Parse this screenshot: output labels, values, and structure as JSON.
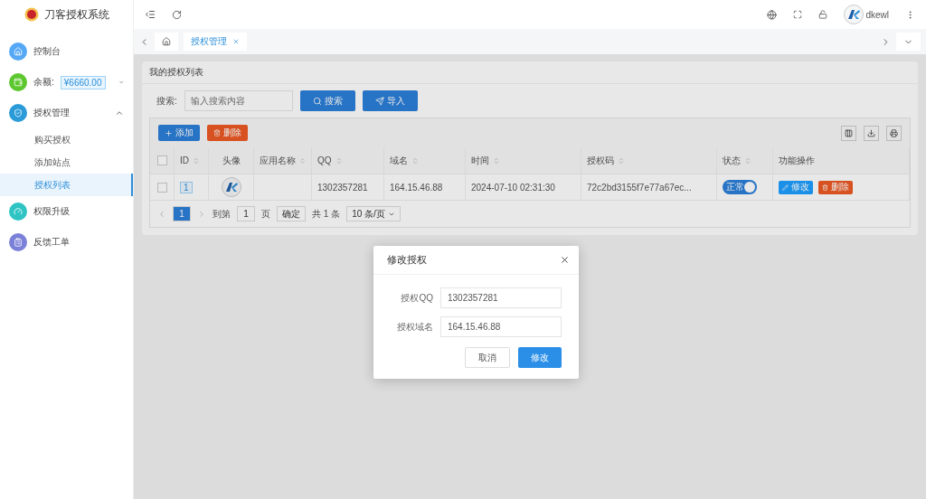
{
  "app_title": "刀客授权系统",
  "sidebar": {
    "items": [
      {
        "label": "控制台",
        "color": "#55a8f5"
      },
      {
        "label": "余额:",
        "badge": "¥6660.00",
        "color": "#5cc72e",
        "expanded": false
      },
      {
        "label": "授权管理",
        "color": "#2b9bd8",
        "expanded": true,
        "children": [
          {
            "label": "购买授权",
            "selected": false
          },
          {
            "label": "添加站点",
            "selected": false
          },
          {
            "label": "授权列表",
            "selected": true
          }
        ]
      },
      {
        "label": "权限升级",
        "color": "#2ec4c4"
      },
      {
        "label": "反馈工单",
        "color": "#7b80d8"
      }
    ]
  },
  "top_bar": {
    "user": "dkewl"
  },
  "tabs": [
    {
      "label": "授权管理",
      "selected": true
    }
  ],
  "panel": {
    "title": "我的授权列表",
    "search_label": "搜索:",
    "search_placeholder": "输入搜索内容",
    "search_button": "搜索",
    "import_button": "导入"
  },
  "table": {
    "add_button": "添加",
    "delete_button": "删除",
    "columns": [
      {
        "label": "ID",
        "sortable": true
      },
      {
        "label": "头像",
        "sortable": false
      },
      {
        "label": "应用名称",
        "sortable": true
      },
      {
        "label": "QQ",
        "sortable": true
      },
      {
        "label": "域名",
        "sortable": true
      },
      {
        "label": "时间",
        "sortable": true
      },
      {
        "label": "授权码",
        "sortable": true
      },
      {
        "label": "状态",
        "sortable": true
      },
      {
        "label": "功能操作",
        "sortable": false
      }
    ],
    "header_checked": false,
    "rows": [
      {
        "checked": false,
        "id": "1",
        "qq": "1302357281",
        "domain": "164.15.46.88",
        "time": "2024-07-10 02:31:30",
        "code": "72c2bd3155f7e77a67ec...",
        "status": {
          "label": "正常",
          "on": true
        },
        "edit": "修改",
        "delete": "删除"
      }
    ]
  },
  "pagination": {
    "current": "1",
    "goto_label": "到第",
    "goto_value": "1",
    "page_label": "页",
    "confirm": "确定",
    "total": "共 1 条",
    "page_size": "10 条/页"
  },
  "modal": {
    "title": "修改授权",
    "fields": [
      {
        "label": "授权QQ",
        "value": "1302357281"
      },
      {
        "label": "授权域名",
        "value": "164.15.46.88"
      }
    ],
    "cancel": "取消",
    "submit": "修改"
  }
}
